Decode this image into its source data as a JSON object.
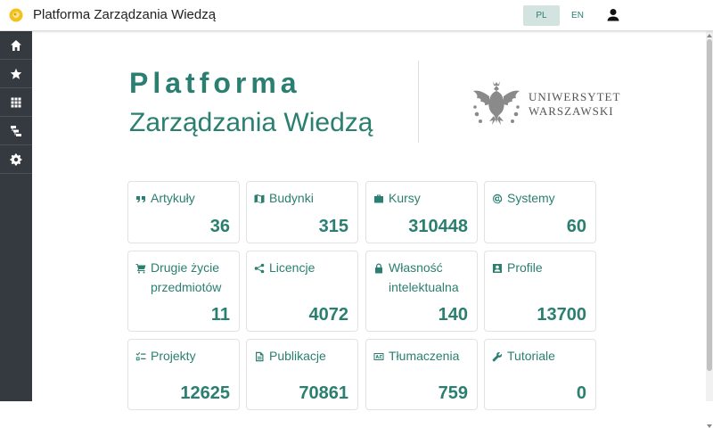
{
  "app": {
    "title": "Platforma Zarządzania Wiedzą"
  },
  "languages": [
    {
      "code": "PL",
      "active": true
    },
    {
      "code": "EN",
      "active": false
    }
  ],
  "sidebar": {
    "items": [
      {
        "icon": "home-icon"
      },
      {
        "icon": "star-icon"
      },
      {
        "icon": "grid-icon"
      },
      {
        "icon": "tree-icon"
      },
      {
        "icon": "gear-icon"
      }
    ]
  },
  "hero": {
    "line1": "Platforma",
    "line2": "Zarządzania Wiedzą"
  },
  "university": {
    "name_line1": "UNIWERSYTET",
    "name_line2": "WARSZAWSKI"
  },
  "colors": {
    "accent": "#2a7f70",
    "sidebar": "#343a40"
  },
  "stats": [
    {
      "label": "Artykuły",
      "value": "36",
      "icon": "quote-icon"
    },
    {
      "label": "Budynki",
      "value": "315",
      "icon": "map-icon"
    },
    {
      "label": "Kursy",
      "value": "310448",
      "icon": "briefcase-icon"
    },
    {
      "label": "Systemy",
      "value": "60",
      "icon": "at-icon"
    },
    {
      "label": "Drugie życie przedmiotów",
      "value": "11",
      "icon": "cart-icon"
    },
    {
      "label": "Licencje",
      "value": "4072",
      "icon": "share-icon"
    },
    {
      "label": "Własność intelektualna",
      "value": "140",
      "icon": "lock-icon"
    },
    {
      "label": "Profile",
      "value": "13700",
      "icon": "profile-icon"
    },
    {
      "label": "Projekty",
      "value": "12625",
      "icon": "checklist-icon"
    },
    {
      "label": "Publikacje",
      "value": "70861",
      "icon": "document-icon"
    },
    {
      "label": "Tłumaczenia",
      "value": "759",
      "icon": "translate-icon"
    },
    {
      "label": "Tutoriale",
      "value": "0",
      "icon": "wrench-icon"
    }
  ]
}
